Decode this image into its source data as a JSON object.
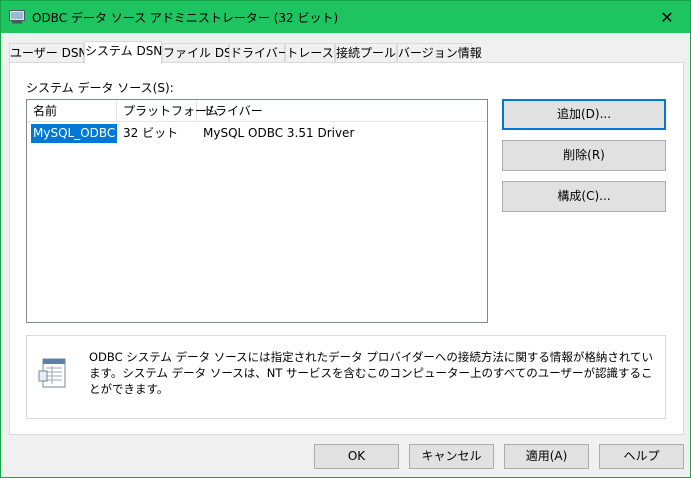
{
  "window": {
    "title": "ODBC データ ソース アドミニストレーター (32 ビット)",
    "close_glyph": "✕"
  },
  "tabs": [
    {
      "label": "ユーザー DSN"
    },
    {
      "label": "システム DSN",
      "active": true
    },
    {
      "label": "ファイル DSN"
    },
    {
      "label": "ドライバー"
    },
    {
      "label": "トレース"
    },
    {
      "label": "接続プール"
    },
    {
      "label": "バージョン情報"
    }
  ],
  "system_dsn": {
    "list_label": "システム データ ソース(S):",
    "columns": [
      "名前",
      "プラットフォーム",
      "ドライバー"
    ],
    "rows": [
      {
        "name": "MySQL_ODBC",
        "platform": "32 ビット",
        "driver": "MySQL ODBC 3.51 Driver",
        "selected": true
      }
    ],
    "buttons": {
      "add": "追加(D)...",
      "remove": "削除(R)",
      "configure": "構成(C)..."
    },
    "info_text": "ODBC システム データ ソースには指定されたデータ プロバイダーへの接続方法に関する情報が格納されています。システム データ ソースは、NT サービスを含むこのコンピューター上のすべてのユーザーが認識することができます。"
  },
  "footer": {
    "ok": "OK",
    "cancel": "キャンセル",
    "apply": "適用(A)",
    "help": "ヘルプ"
  },
  "colors": {
    "titlebar": "#1ec45f",
    "selection": "#0078d7"
  }
}
